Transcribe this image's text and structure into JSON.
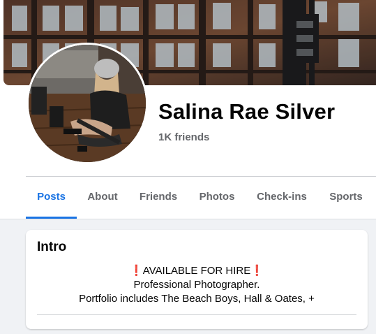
{
  "profile": {
    "name": "Salina Rae Silver",
    "friends": "1K friends"
  },
  "tabs": [
    {
      "label": "Posts",
      "active": true
    },
    {
      "label": "About"
    },
    {
      "label": "Friends"
    },
    {
      "label": "Photos"
    },
    {
      "label": "Check-ins"
    },
    {
      "label": "Sports"
    }
  ],
  "intro": {
    "title": "Intro",
    "bio_mark": "❗",
    "bio_line1": "AVAILABLE FOR HIRE",
    "bio_line2": "Professional Photographer.",
    "bio_line3": "Portfolio includes The Beach Boys, Hall & Oates, +"
  },
  "colors": {
    "accent": "#1b74e4",
    "text_primary": "#050505",
    "text_secondary": "#65676b",
    "page_bg": "#f0f2f5",
    "exclamation": "#dd2e44"
  }
}
